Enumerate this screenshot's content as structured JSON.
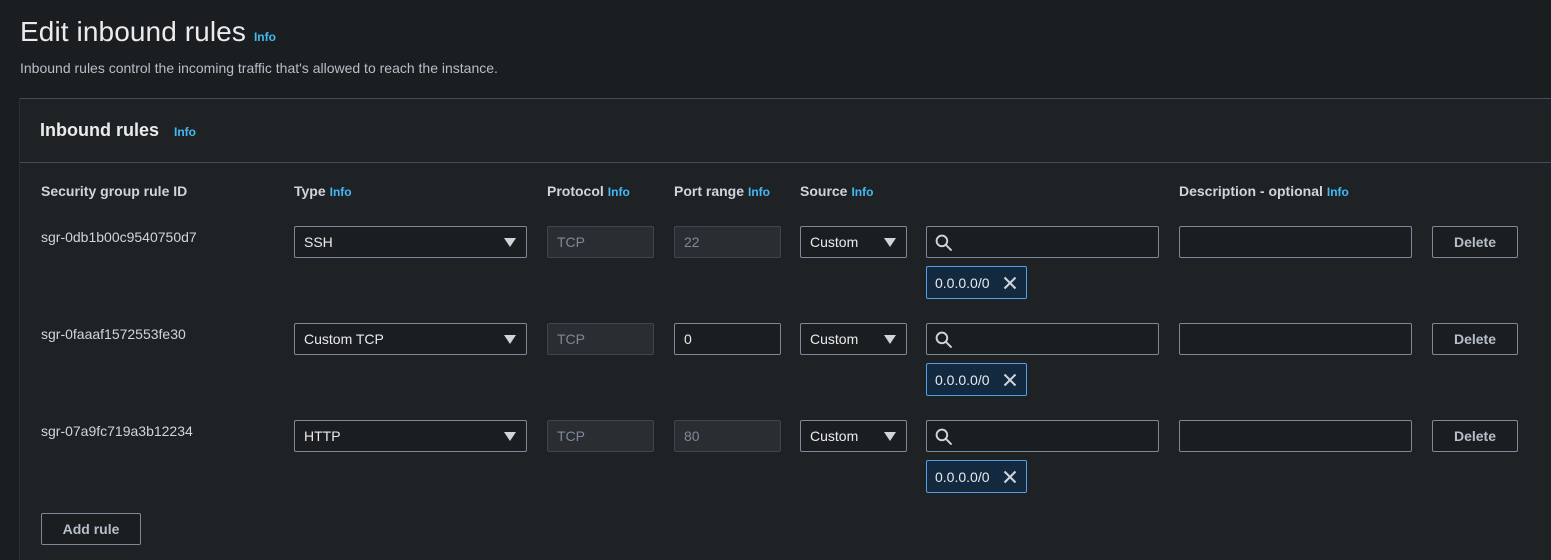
{
  "page": {
    "title": "Edit inbound rules",
    "title_info": "Info",
    "description": "Inbound rules control the incoming traffic that's allowed to reach the instance."
  },
  "panel": {
    "title": "Inbound rules",
    "info": "Info"
  },
  "columns": {
    "rule_id": "Security group rule ID",
    "type": "Type",
    "type_info": "Info",
    "protocol": "Protocol",
    "protocol_info": "Info",
    "port_range": "Port range",
    "port_range_info": "Info",
    "source": "Source",
    "source_info": "Info",
    "description": "Description - optional",
    "description_info": "Info"
  },
  "rules": [
    {
      "id": "sgr-0db1b00c9540750d7",
      "type": "SSH",
      "protocol": "TCP",
      "port_range": "22",
      "port_editable": false,
      "source": "Custom",
      "search_value": "",
      "cidr_token": "0.0.0.0/0",
      "description": "",
      "delete_label": "Delete"
    },
    {
      "id": "sgr-0faaaf1572553fe30",
      "type": "Custom TCP",
      "protocol": "TCP",
      "port_range": "0",
      "port_editable": true,
      "source": "Custom",
      "search_value": "",
      "cidr_token": "0.0.0.0/0",
      "description": "",
      "delete_label": "Delete"
    },
    {
      "id": "sgr-07a9fc719a3b12234",
      "type": "HTTP",
      "protocol": "TCP",
      "port_range": "80",
      "port_editable": false,
      "source": "Custom",
      "search_value": "",
      "cidr_token": "0.0.0.0/0",
      "description": "",
      "delete_label": "Delete"
    }
  ],
  "add_rule_label": "Add rule",
  "colors": {
    "background": "#1b1e21",
    "info_link": "#44b9f6",
    "token_border": "#539fe5",
    "disabled_field": "#2a2e33"
  }
}
